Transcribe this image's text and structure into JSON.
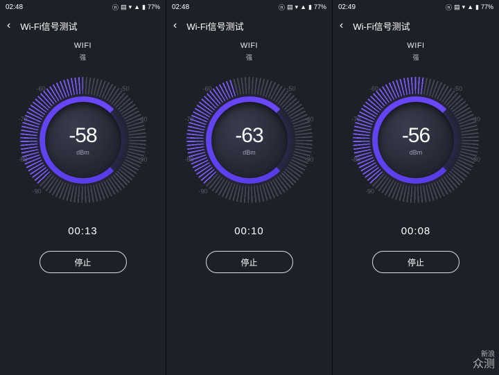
{
  "watermark": {
    "line1": "新浪",
    "line2": "众测"
  },
  "screens": [
    {
      "status": {
        "time": "02:48",
        "battery": "77%"
      },
      "header": {
        "title": "Wi-Fi信号测试"
      },
      "network": {
        "ssid": "WIFI",
        "strength": "强"
      },
      "gauge": {
        "value": "-58",
        "unit": "dBm",
        "labels": {
          "l90": "-90",
          "l80": "-80",
          "l70": "-70",
          "l60": "-60",
          "l50": "-50",
          "l40": "-40",
          "l30": "-30"
        }
      },
      "timer": "00:13",
      "button": {
        "stop": "停止"
      }
    },
    {
      "status": {
        "time": "02:48",
        "battery": "77%"
      },
      "header": {
        "title": "Wi-Fi信号测试"
      },
      "network": {
        "ssid": "WIFI",
        "strength": "强"
      },
      "gauge": {
        "value": "-63",
        "unit": "dBm",
        "labels": {
          "l90": "-90",
          "l80": "-80",
          "l70": "-70",
          "l60": "-60",
          "l50": "-50",
          "l40": "-40",
          "l30": "-30"
        }
      },
      "timer": "00:10",
      "button": {
        "stop": "停止"
      }
    },
    {
      "status": {
        "time": "02:49",
        "battery": "77%"
      },
      "header": {
        "title": "Wi-Fi信号测试"
      },
      "network": {
        "ssid": "WIFI",
        "strength": "强"
      },
      "gauge": {
        "value": "-56",
        "unit": "dBm",
        "labels": {
          "l90": "-90",
          "l80": "-80",
          "l70": "-70",
          "l60": "-60",
          "l50": "-50",
          "l40": "-40",
          "l30": "-30"
        }
      },
      "timer": "00:08",
      "button": {
        "stop": "停止"
      }
    }
  ],
  "chart_data": [
    {
      "type": "gauge",
      "title": "Wi-Fi信号测试",
      "value": -58,
      "unit": "dBm",
      "range": [
        -90,
        -30
      ],
      "ticks": [
        -90,
        -80,
        -70,
        -60,
        -50,
        -40,
        -30
      ],
      "elapsed": "00:13",
      "strength": "强"
    },
    {
      "type": "gauge",
      "title": "Wi-Fi信号测试",
      "value": -63,
      "unit": "dBm",
      "range": [
        -90,
        -30
      ],
      "ticks": [
        -90,
        -80,
        -70,
        -60,
        -50,
        -40,
        -30
      ],
      "elapsed": "00:10",
      "strength": "强"
    },
    {
      "type": "gauge",
      "title": "Wi-Fi信号测试",
      "value": -56,
      "unit": "dBm",
      "range": [
        -90,
        -30
      ],
      "ticks": [
        -90,
        -80,
        -70,
        -60,
        -50,
        -40,
        -30
      ],
      "elapsed": "00:08",
      "strength": "强"
    }
  ]
}
